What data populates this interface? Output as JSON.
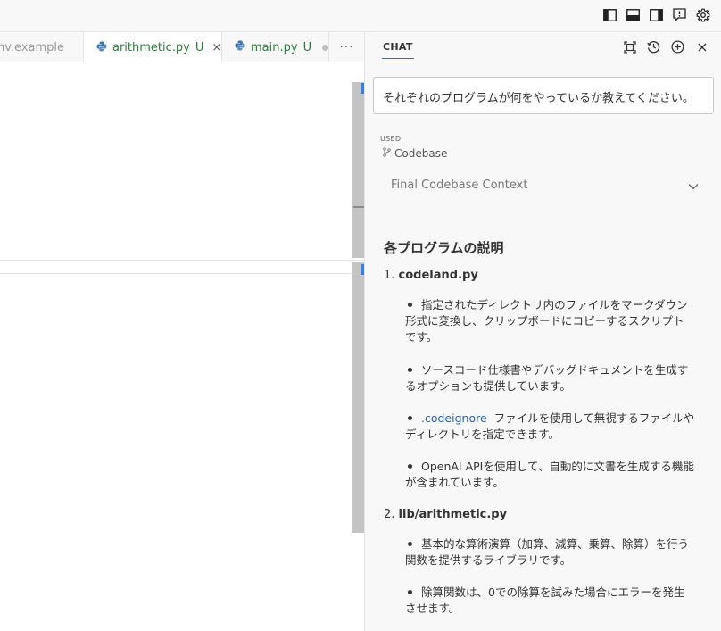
{
  "editor": {
    "tabs": [
      {
        "label": "nv.example",
        "badge": ""
      },
      {
        "label": "arithmetic.py",
        "badge": "U",
        "close": "×"
      },
      {
        "label": "main.py",
        "badge": "U"
      },
      {
        "label": "···"
      }
    ]
  },
  "chat": {
    "title": "CHAT",
    "prompt": "それぞれのプログラムが何をやっているか教えてください。",
    "used_label": "USED",
    "used_ref": "Codebase",
    "context_label": "Final Codebase Context",
    "answer": {
      "heading": "各プログラムの説明",
      "items": [
        {
          "num": "1.",
          "name": "codeland.py",
          "bullets": [
            {
              "line1": "指定されたディレクトリ内のファイルをマークダウン",
              "line2": "形式に変換し、クリップボードにコピーするスクリプト",
              "line3": "です。"
            },
            {
              "line1": "ソースコード仕様書やデバッグドキュメントを生成す",
              "line2": "るオプションも提供しています。"
            },
            {
              "code": ".codeignore",
              "line1": "ファイルを使用して無視するファイルや",
              "line2": "ディレクトリを指定できます。"
            },
            {
              "line1": "OpenAI APIを使用して、自動的に文書を生成する機能",
              "line2": "が含まれています。"
            }
          ]
        },
        {
          "num": "2.",
          "name": "lib/arithmetic.py",
          "bullets": [
            {
              "line1": "基本的な算術演算（加算、減算、乗算、除算）を行う",
              "line2": "関数を提供するライブラリです。"
            },
            {
              "line1": "除算関数は、0での除算を試みた場合にエラーを発生",
              "line2": "させます。"
            }
          ]
        }
      ]
    }
  },
  "colors": {
    "accent": "#2c6fb6",
    "git_untracked": "#2b7d3c",
    "code_link": "#2c63b0"
  }
}
